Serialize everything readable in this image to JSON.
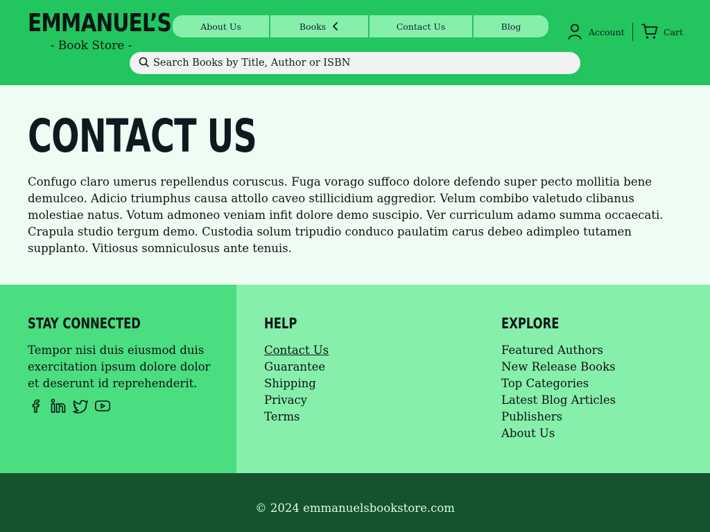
{
  "header": {
    "logo_main": "EMMANUEL’S",
    "logo_sub": "- Book Store -",
    "nav": [
      {
        "label": "About Us"
      },
      {
        "label": "Books"
      },
      {
        "label": "Contact Us"
      },
      {
        "label": "Blog"
      }
    ],
    "account_label": "Account",
    "cart_label": "Cart",
    "search_placeholder": "Search Books by Title, Author or ISBN"
  },
  "main": {
    "title": "CONTACT US",
    "body": "Confugo claro umerus repellendus coruscus. Fuga vorago suffoco dolore defendo super pecto mollitia bene demulceo. Adicio triumphus causa attollo caveo stillicidium aggredior. Velum combibo valetudo clibanus molestiae natus. Votum admoneo veniam infit dolore demo suscipio. Ver curriculum adamo summa occaecati. Crapula studio tergum demo. Custodia solum tripudio conduco paulatim carus debeo adimpleo tutamen supplanto. Vitiosus somniculosus ante tenuis."
  },
  "footer": {
    "stay_connected": {
      "heading": "STAY CONNECTED",
      "text": "Tempor nisi duis eiusmod duis exercitation ipsum dolore dolor et deserunt id reprehenderit.",
      "socials": [
        "facebook-icon",
        "linkedin-icon",
        "twitter-icon",
        "youtube-icon"
      ]
    },
    "help": {
      "heading": "HELP",
      "links": [
        "Contact Us",
        "Guarantee",
        "Shipping",
        "Privacy",
        "Terms"
      ]
    },
    "explore": {
      "heading": "EXPLORE",
      "links": [
        "Featured Authors",
        "New Release Books",
        "Top Categories",
        "Latest Blog Articles",
        "Publishers",
        "About Us"
      ]
    },
    "copyright": "© 2024 emmanuelsbookstore.com"
  },
  "colors": {
    "header_bg": "#22c55e",
    "nav_bg": "#86efac",
    "main_bg": "#effcf4",
    "footer_left_bg": "#4ade80",
    "footer_right_bg": "#86efac",
    "bottom_bg": "#14532d"
  }
}
